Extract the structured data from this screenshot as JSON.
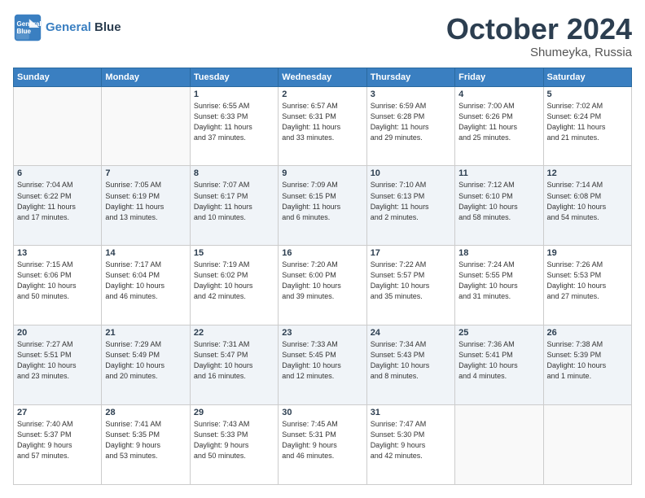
{
  "logo": {
    "line1": "General",
    "line2": "Blue"
  },
  "title": "October 2024",
  "subtitle": "Shumeyka, Russia",
  "days_of_week": [
    "Sunday",
    "Monday",
    "Tuesday",
    "Wednesday",
    "Thursday",
    "Friday",
    "Saturday"
  ],
  "weeks": [
    [
      {
        "day": "",
        "details": ""
      },
      {
        "day": "",
        "details": ""
      },
      {
        "day": "1",
        "details": "Sunrise: 6:55 AM\nSunset: 6:33 PM\nDaylight: 11 hours\nand 37 minutes."
      },
      {
        "day": "2",
        "details": "Sunrise: 6:57 AM\nSunset: 6:31 PM\nDaylight: 11 hours\nand 33 minutes."
      },
      {
        "day": "3",
        "details": "Sunrise: 6:59 AM\nSunset: 6:28 PM\nDaylight: 11 hours\nand 29 minutes."
      },
      {
        "day": "4",
        "details": "Sunrise: 7:00 AM\nSunset: 6:26 PM\nDaylight: 11 hours\nand 25 minutes."
      },
      {
        "day": "5",
        "details": "Sunrise: 7:02 AM\nSunset: 6:24 PM\nDaylight: 11 hours\nand 21 minutes."
      }
    ],
    [
      {
        "day": "6",
        "details": "Sunrise: 7:04 AM\nSunset: 6:22 PM\nDaylight: 11 hours\nand 17 minutes."
      },
      {
        "day": "7",
        "details": "Sunrise: 7:05 AM\nSunset: 6:19 PM\nDaylight: 11 hours\nand 13 minutes."
      },
      {
        "day": "8",
        "details": "Sunrise: 7:07 AM\nSunset: 6:17 PM\nDaylight: 11 hours\nand 10 minutes."
      },
      {
        "day": "9",
        "details": "Sunrise: 7:09 AM\nSunset: 6:15 PM\nDaylight: 11 hours\nand 6 minutes."
      },
      {
        "day": "10",
        "details": "Sunrise: 7:10 AM\nSunset: 6:13 PM\nDaylight: 11 hours\nand 2 minutes."
      },
      {
        "day": "11",
        "details": "Sunrise: 7:12 AM\nSunset: 6:10 PM\nDaylight: 10 hours\nand 58 minutes."
      },
      {
        "day": "12",
        "details": "Sunrise: 7:14 AM\nSunset: 6:08 PM\nDaylight: 10 hours\nand 54 minutes."
      }
    ],
    [
      {
        "day": "13",
        "details": "Sunrise: 7:15 AM\nSunset: 6:06 PM\nDaylight: 10 hours\nand 50 minutes."
      },
      {
        "day": "14",
        "details": "Sunrise: 7:17 AM\nSunset: 6:04 PM\nDaylight: 10 hours\nand 46 minutes."
      },
      {
        "day": "15",
        "details": "Sunrise: 7:19 AM\nSunset: 6:02 PM\nDaylight: 10 hours\nand 42 minutes."
      },
      {
        "day": "16",
        "details": "Sunrise: 7:20 AM\nSunset: 6:00 PM\nDaylight: 10 hours\nand 39 minutes."
      },
      {
        "day": "17",
        "details": "Sunrise: 7:22 AM\nSunset: 5:57 PM\nDaylight: 10 hours\nand 35 minutes."
      },
      {
        "day": "18",
        "details": "Sunrise: 7:24 AM\nSunset: 5:55 PM\nDaylight: 10 hours\nand 31 minutes."
      },
      {
        "day": "19",
        "details": "Sunrise: 7:26 AM\nSunset: 5:53 PM\nDaylight: 10 hours\nand 27 minutes."
      }
    ],
    [
      {
        "day": "20",
        "details": "Sunrise: 7:27 AM\nSunset: 5:51 PM\nDaylight: 10 hours\nand 23 minutes."
      },
      {
        "day": "21",
        "details": "Sunrise: 7:29 AM\nSunset: 5:49 PM\nDaylight: 10 hours\nand 20 minutes."
      },
      {
        "day": "22",
        "details": "Sunrise: 7:31 AM\nSunset: 5:47 PM\nDaylight: 10 hours\nand 16 minutes."
      },
      {
        "day": "23",
        "details": "Sunrise: 7:33 AM\nSunset: 5:45 PM\nDaylight: 10 hours\nand 12 minutes."
      },
      {
        "day": "24",
        "details": "Sunrise: 7:34 AM\nSunset: 5:43 PM\nDaylight: 10 hours\nand 8 minutes."
      },
      {
        "day": "25",
        "details": "Sunrise: 7:36 AM\nSunset: 5:41 PM\nDaylight: 10 hours\nand 4 minutes."
      },
      {
        "day": "26",
        "details": "Sunrise: 7:38 AM\nSunset: 5:39 PM\nDaylight: 10 hours\nand 1 minute."
      }
    ],
    [
      {
        "day": "27",
        "details": "Sunrise: 7:40 AM\nSunset: 5:37 PM\nDaylight: 9 hours\nand 57 minutes."
      },
      {
        "day": "28",
        "details": "Sunrise: 7:41 AM\nSunset: 5:35 PM\nDaylight: 9 hours\nand 53 minutes."
      },
      {
        "day": "29",
        "details": "Sunrise: 7:43 AM\nSunset: 5:33 PM\nDaylight: 9 hours\nand 50 minutes."
      },
      {
        "day": "30",
        "details": "Sunrise: 7:45 AM\nSunset: 5:31 PM\nDaylight: 9 hours\nand 46 minutes."
      },
      {
        "day": "31",
        "details": "Sunrise: 7:47 AM\nSunset: 5:30 PM\nDaylight: 9 hours\nand 42 minutes."
      },
      {
        "day": "",
        "details": ""
      },
      {
        "day": "",
        "details": ""
      }
    ]
  ]
}
